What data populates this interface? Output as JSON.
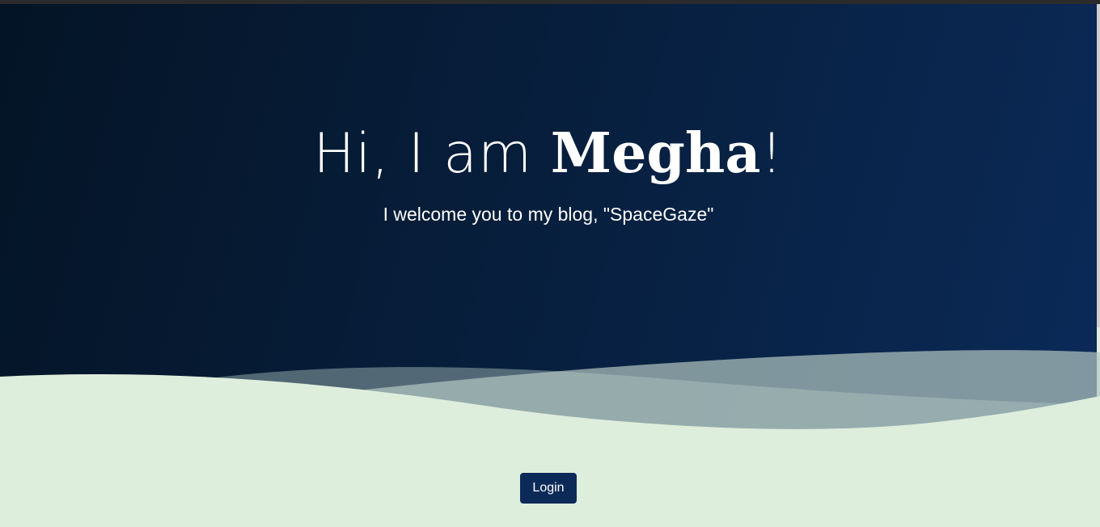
{
  "hero": {
    "greeting": "Hi, I am ",
    "name": "Megha",
    "punctuation": "!",
    "subtitle": "I welcome you to my blog, \"SpaceGaze\""
  },
  "actions": {
    "login_label": "Login"
  },
  "colors": {
    "hero_dark": "#041426",
    "hero_light": "#0b2a58",
    "wave_fill": "#deeedc",
    "button_bg": "#0b2a58"
  }
}
